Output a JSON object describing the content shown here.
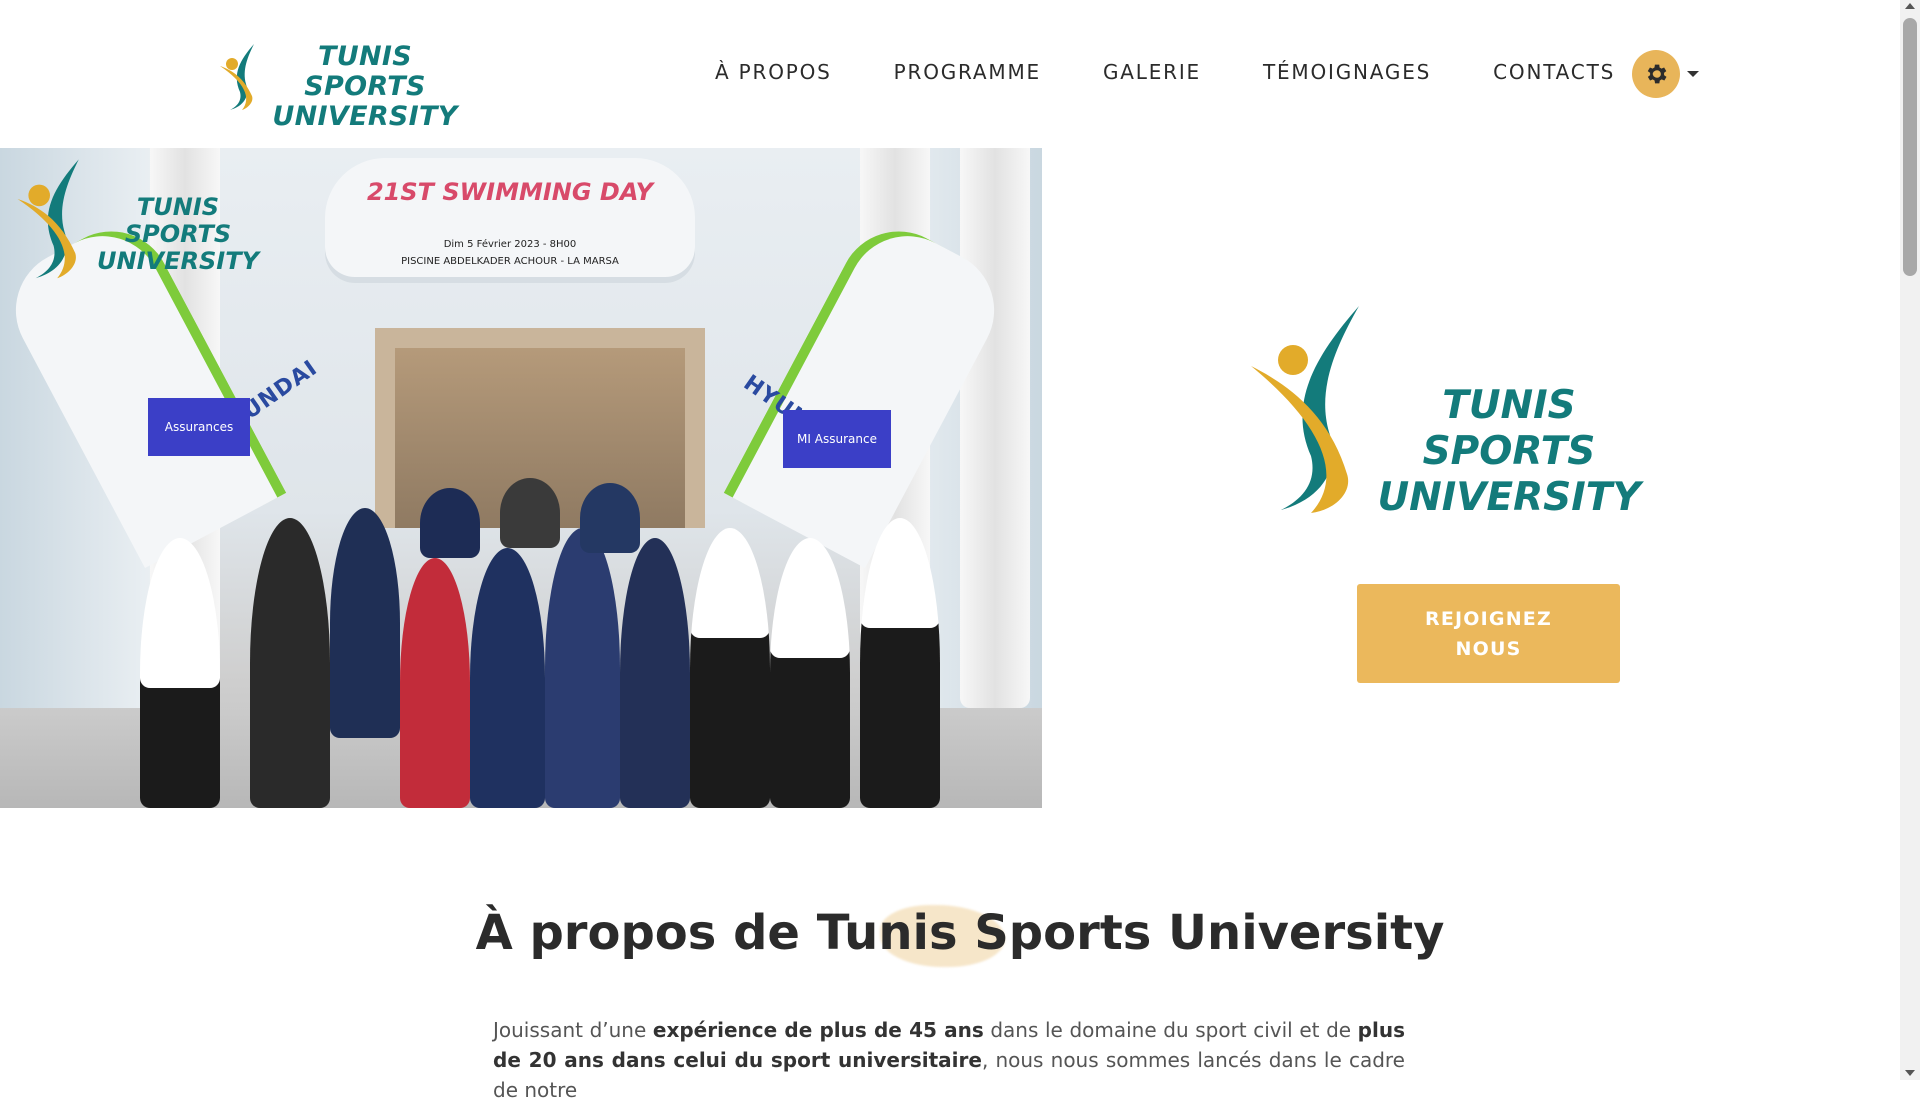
{
  "brand": {
    "line1": "TUNIS SPORTS",
    "line2": "UNIVERSITY"
  },
  "nav": {
    "items": [
      "À PROPOS",
      "PROGRAMME",
      "GALERIE",
      "TÉMOIGNAGES",
      "CONTACTS"
    ]
  },
  "settings": {
    "icon": "gear-icon"
  },
  "hero": {
    "photo": {
      "arch_title": "21ST SWIMMING DAY",
      "arch_line1": "Dim 5 Février 2023 - 8H00",
      "arch_line2": "PISCINE ABDELKADER ACHOUR - LA MARSA",
      "sponsor": "HYUNDAI",
      "sign_left": "Assurances",
      "sign_right": "MI Assurance"
    },
    "logo": {
      "line1": "TUNIS SPORTS",
      "line2": "UNIVERSITY"
    },
    "cta": "REJOIGNEZ\nNOUS",
    "cta_line1": "REJOIGNEZ",
    "cta_line2": "NOUS"
  },
  "about": {
    "title": "À propos de Tunis Sports University",
    "p_1": "Jouissant d’une ",
    "p_b1": "expérience de plus de 45 ans",
    "p_2": " dans le domaine du sport civil et de ",
    "p_b2": "plus de 20 ans dans celui du sport universitaire",
    "p_3": ", nous nous sommes lancés dans le cadre de notre"
  },
  "colors": {
    "accent": "#ebb85c",
    "brand_teal": "#137b7b",
    "text": "#2b2b2b"
  }
}
